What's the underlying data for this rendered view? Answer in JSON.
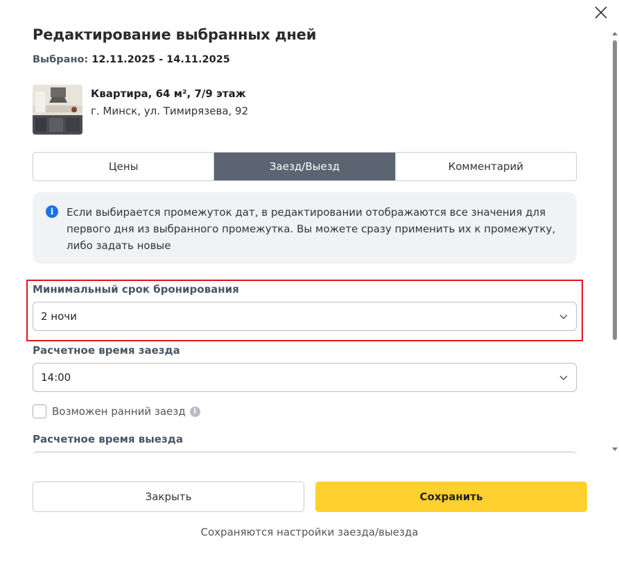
{
  "dialog": {
    "title": "Редактирование выбранных дней",
    "selected_label": "Выбрано:",
    "selected_range": "12.11.2025 - 14.11.2025"
  },
  "property": {
    "name": "Квартира, 64 м², 7/9 этаж",
    "address": "г. Минск, ул. Тимирязева, 92"
  },
  "tabs": [
    {
      "label": "Цены",
      "active": false
    },
    {
      "label": "Заезд/Выезд",
      "active": true
    },
    {
      "label": "Комментарий",
      "active": false
    }
  ],
  "info": {
    "icon": "info-icon",
    "text": "Если выбирается промежуток дат, в редактировании отображаются все значения для первого дня из выбранного промежутка. Вы можете сразу применить их к промежутку, либо задать новые"
  },
  "fields": {
    "min_stay": {
      "label": "Минимальный срок бронирования",
      "value": "2 ночи"
    },
    "checkin_time": {
      "label": "Расчетное время заезда",
      "value": "14:00"
    },
    "early_checkin": {
      "label": "Возможен ранний заезд",
      "checked": false
    },
    "checkout_time": {
      "label": "Расчетное время выезда"
    }
  },
  "buttons": {
    "close": "Закрыть",
    "save": "Сохранить"
  },
  "footer_note": "Сохраняются настройки заезда/выезда",
  "colors": {
    "accent_yellow": "#ffd12e",
    "active_tab": "#5b6471",
    "highlight_red": "#e0141e",
    "info_blue": "#1a73e8"
  }
}
